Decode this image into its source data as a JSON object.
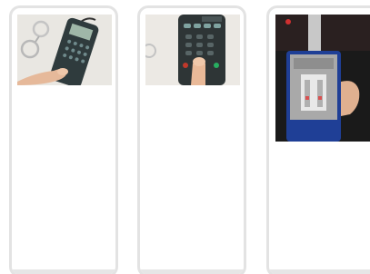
{
  "cards": [
    {
      "image": "breathalyzer-keypad-photo"
    },
    {
      "image": "breathalyzer-keypad-closeup-photo"
    },
    {
      "image": "breath-test-device-screen-photo"
    }
  ]
}
